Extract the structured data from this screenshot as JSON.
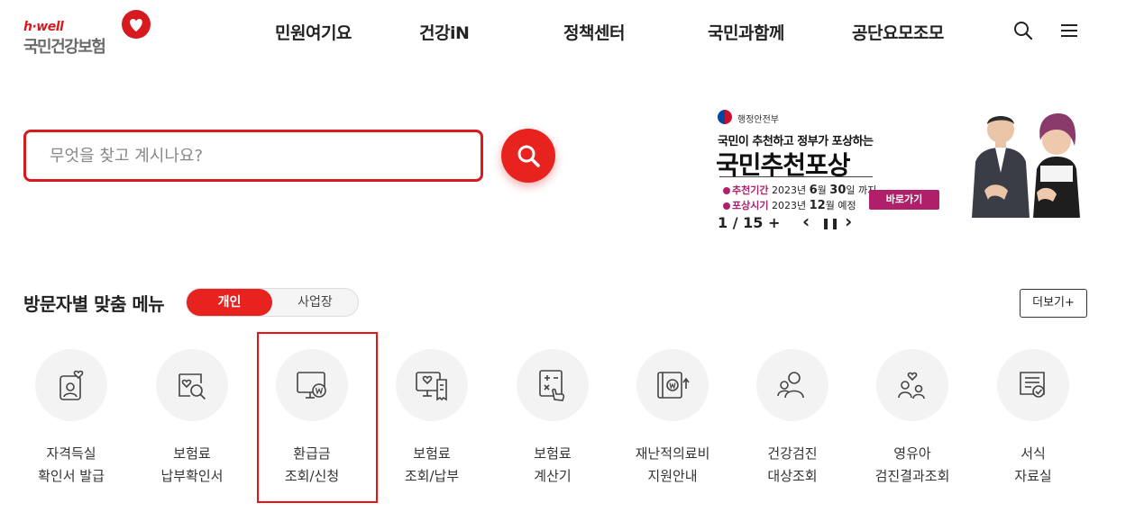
{
  "header": {
    "logo_top": "h·well",
    "logo_name": "국민건강보험",
    "nav": [
      "민원여기요",
      "건강iN",
      "정책센터",
      "국민과함께",
      "공단요모조모"
    ]
  },
  "search": {
    "placeholder": "무엇을 찾고 계시나요?",
    "value": ""
  },
  "banner": {
    "ministry": "행정안전부",
    "subtitle": "국민이 추천하고 정부가 포상하는",
    "title": "국민추천포상",
    "row1_tag": "추천기간",
    "row1_prefix": "2023년",
    "row1_month": "6",
    "row1_month_unit": "월",
    "row1_day": "30",
    "row1_suffix": "일 까지",
    "row2_tag": "포상시기",
    "row2_prefix": "2023년",
    "row2_month": "12",
    "row2_suffix": "월 예정",
    "go_label": "바로가기"
  },
  "slider": {
    "pager": "1 / 15",
    "plus": "+",
    "prev": "‹",
    "pause": "❚❚",
    "next": "›"
  },
  "visitor_menu": {
    "title": "방문자별 맞춤 메뉴",
    "toggle": [
      "개인",
      "사업장"
    ],
    "more_label": "더보기+",
    "items": [
      {
        "line1": "자격득실",
        "line2": "확인서 발급",
        "icon": "id-card-heart-icon"
      },
      {
        "line1": "보험료",
        "line2": "납부확인서",
        "icon": "document-search-icon"
      },
      {
        "line1": "환급금",
        "line2": "조회/신청",
        "icon": "monitor-won-icon"
      },
      {
        "line1": "보험료",
        "line2": "조회/납부",
        "icon": "monitor-receipt-icon"
      },
      {
        "line1": "보험료",
        "line2": "계산기",
        "icon": "calculator-icon"
      },
      {
        "line1": "재난적의료비",
        "line2": "지원안내",
        "icon": "wallet-won-icon"
      },
      {
        "line1": "건강검진",
        "line2": "대상조회",
        "icon": "people-search-icon"
      },
      {
        "line1": "영유아",
        "line2": "검진결과조회",
        "icon": "family-heart-icon"
      },
      {
        "line1": "서식",
        "line2": "자료실",
        "icon": "form-check-icon"
      }
    ]
  },
  "colors": {
    "brand_red": "#d71920",
    "banner_accent": "#b0206a",
    "highlight_box": "#e11111"
  }
}
